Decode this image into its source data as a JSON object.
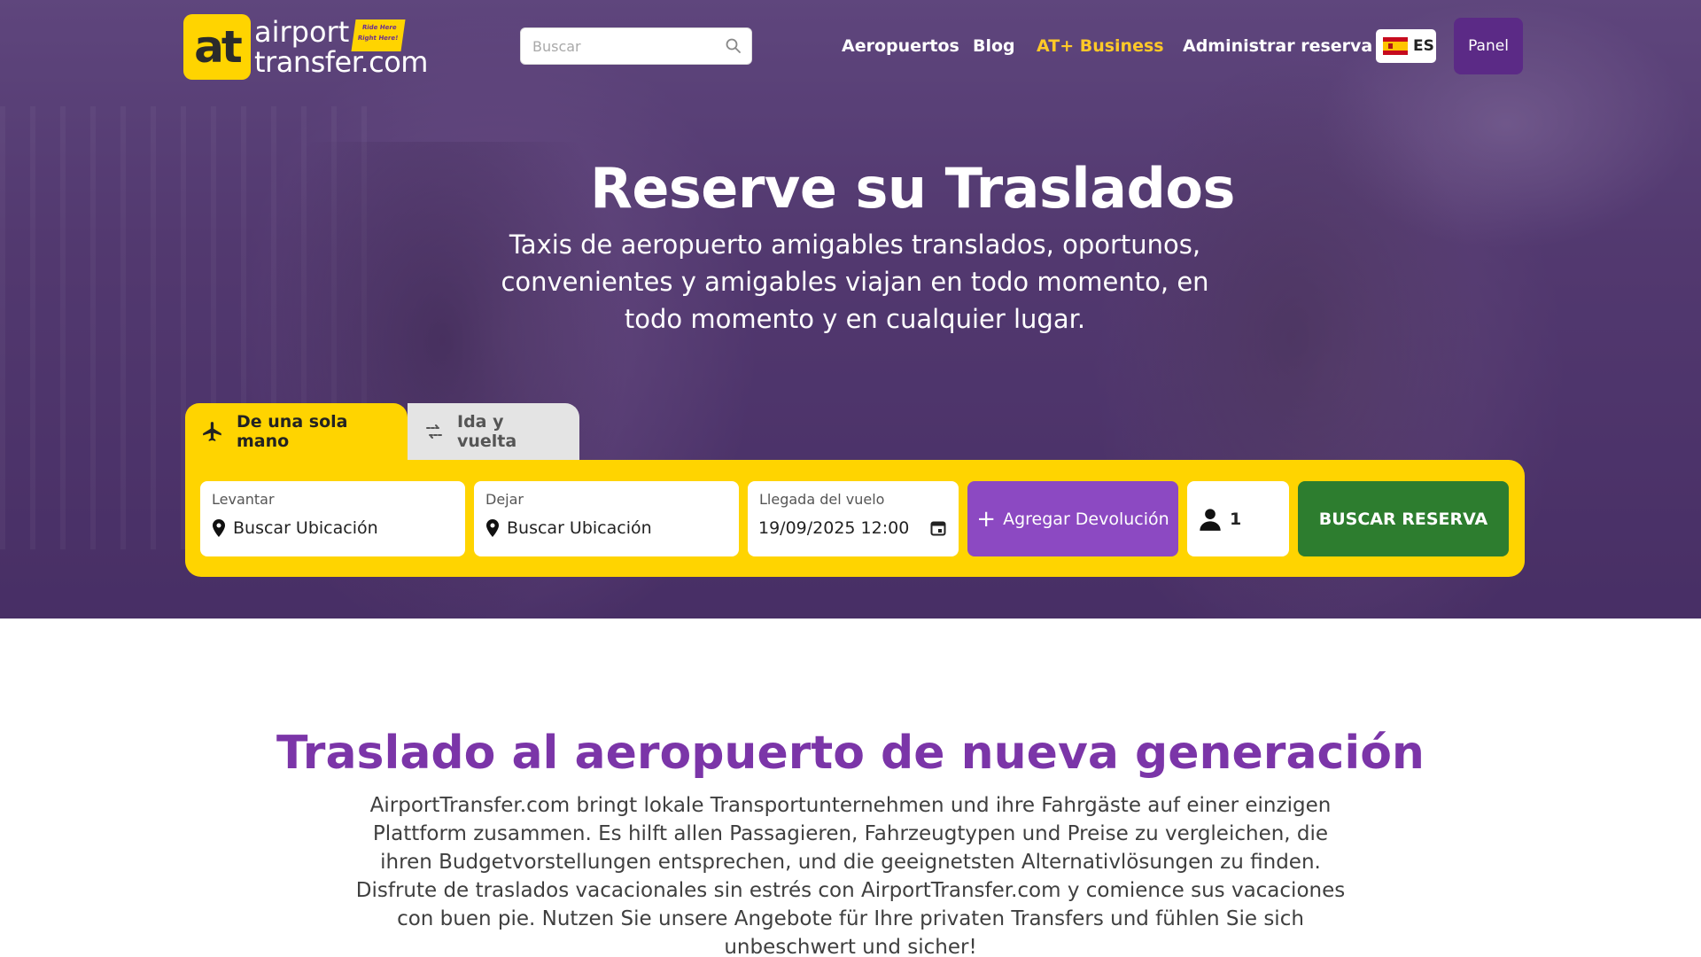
{
  "header": {
    "logo": {
      "badge": "at",
      "line1": "airport",
      "line2": "transfer.com",
      "tag_line1": "Ride Here",
      "tag_line2": "Right Here!"
    },
    "search": {
      "placeholder": "Buscar",
      "icon": "search-icon"
    },
    "nav": [
      {
        "label": "Aeropuertos"
      },
      {
        "label": "Blog"
      },
      {
        "label": "AT+ Business"
      },
      {
        "label": "Administrar reserva"
      }
    ],
    "language": {
      "code": "ES",
      "flag": "spain-flag-icon"
    },
    "panel_label": "Panel"
  },
  "hero": {
    "title": "Reserve su Traslados",
    "subtitle": "Taxis de aeropuerto amigables translados, oportunos, convenientes y amigables viajan en todo momento, en todo momento y en cualquier lugar."
  },
  "booking": {
    "tabs": [
      {
        "label": "De una sola mano",
        "icon": "airplane-icon",
        "active": true
      },
      {
        "label": "Ida y vuelta",
        "icon": "swap-arrows-icon",
        "active": false
      }
    ],
    "pickup": {
      "label": "Levantar",
      "value": "Buscar Ubicación"
    },
    "dropoff": {
      "label": "Dejar",
      "value": "Buscar Ubicación"
    },
    "arrival": {
      "label": "Llegada del vuelo",
      "value": "19/09/2025 12:00"
    },
    "add_return": {
      "icon": "+",
      "label": "Agregar Devolución"
    },
    "passengers": "1",
    "search_button": "BUSCAR RESERVA"
  },
  "section": {
    "title": "Traslado al aeropuerto de nueva generación",
    "body": "AirportTransfer.com bringt lokale Transportunternehmen und ihre Fahrgäste auf einer einzigen Plattform zusammen. Es hilft allen Passagieren, Fahrzeugtypen und Preise zu vergleichen, die ihren Budgetvorstellungen entsprechen, und die geeignetsten Alternativlösungen zu finden. Disfrute de traslados vacacionales sin estrés con AirportTransfer.com y comience sus vacaciones con buen pie. Nutzen Sie unsere Angebote für Ihre privaten Transfers und fühlen Sie sich unbeschwert und sicher!"
  },
  "colors": {
    "brand_yellow": "#ffd400",
    "brand_purple": "#7b35a8",
    "panel_purple": "#5b2a86",
    "return_purple": "#8c49c2",
    "search_green": "#2d7d2f",
    "business_orange": "#ffc928"
  }
}
